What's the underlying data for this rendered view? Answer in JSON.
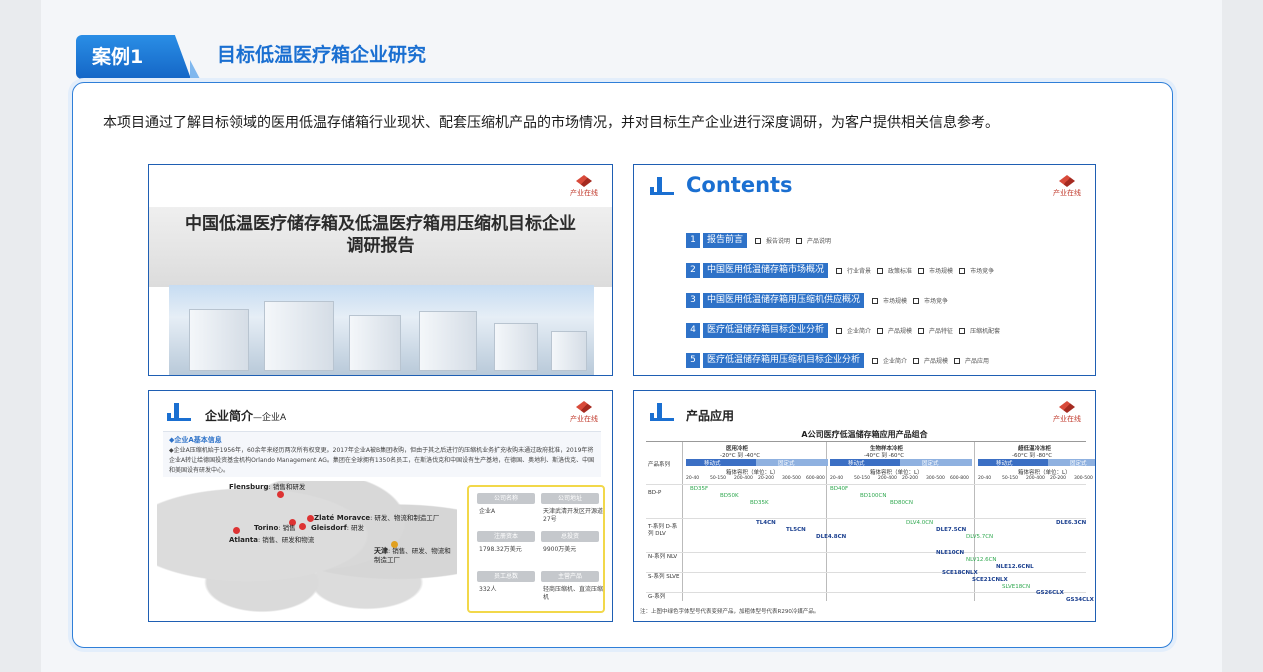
{
  "header": {
    "tag_label": "案例1",
    "title": "目标低温医疗箱企业研究"
  },
  "intro": "本项目通过了解目标领域的医用低温存储箱行业现状、配套压缩机产品的市场情况，并对目标生产企业进行深度调研，为客户提供相关信息参考。",
  "logo": {
    "text": "产业在线",
    "sub": "CHINAIOL.COM"
  },
  "cover": {
    "title_line1": "中国低温医疗储存箱及低温医疗箱用压缩机目标企业",
    "title_line2": "调研报告"
  },
  "contents": {
    "title": "Contents",
    "items": [
      {
        "num": "1",
        "label": "报告前言",
        "subs": [
          "报告说明",
          "产品说明"
        ]
      },
      {
        "num": "2",
        "label": "中国医用低温储存箱市场概况",
        "subs": [
          "行业背景",
          "政策标准",
          "市场规模",
          "市场竞争"
        ]
      },
      {
        "num": "3",
        "label": "中国医用低温储存箱用压缩机供应概况",
        "subs": [
          "市场规模",
          "市场竞争"
        ]
      },
      {
        "num": "4",
        "label": "医疗低温储存箱目标企业分析",
        "subs": [
          "企业简介",
          "产品规模",
          "产品特征",
          "压缩机配套"
        ]
      },
      {
        "num": "5",
        "label": "医疗低温储存箱用压缩机目标企业分析",
        "subs": [
          "企业简介",
          "产品规模",
          "产品应用"
        ]
      }
    ]
  },
  "company": {
    "heading": "企业简介",
    "heading_sub": "—企业A",
    "info_title": "◆企业A基本信息",
    "info_text": "◆企业A压缩机始于1956年，60余年来经历两次所有权变更。2017年企业A被B集团收购，但由于其之后进行的压缩机业务扩充收购未通过政府批准，2019年将企业A转让给德国投资基金机构Orlando Management AG。集团在全球拥有1350名员工，在斯洛伐克和中国设有生产基地，在德国、奥地利、斯洛伐克、中国和美国设有研发中心。",
    "cities": [
      {
        "name": "Flensburg",
        "desc": "销售和研发"
      },
      {
        "name": "Zlaté Moravce",
        "desc": "研发、物流和制造工厂"
      },
      {
        "name": "Torino",
        "desc": "销售"
      },
      {
        "name": "Gleisdorf",
        "desc": "研发"
      },
      {
        "name": "Atlanta",
        "desc": "销售、研发和物流"
      },
      {
        "name": "天津",
        "desc": "销售、研发、物流和制造工厂"
      }
    ],
    "facts": [
      {
        "label": "公司名称",
        "value": "企业A"
      },
      {
        "label": "公司地址",
        "value": "天津武清开发区开源道27号"
      },
      {
        "label": "注册资本",
        "value": "1798.32万美元"
      },
      {
        "label": "总投资",
        "value": "9900万美元"
      },
      {
        "label": "员工总数",
        "value": "332人"
      },
      {
        "label": "主营产品",
        "value": "轻商压缩机、直流压缩机"
      }
    ]
  },
  "application": {
    "heading": "产品应用",
    "table_title": "A公司医疗低温储存箱应用产品组合",
    "row_header": "产品系列",
    "groups": [
      {
        "name": "医用冷柜",
        "range": "-20°C 到 -40°C"
      },
      {
        "name": "生物样本冷柜",
        "range": "-40°C 到 -60°C"
      },
      {
        "name": "超低温冷冻柜",
        "range": "-60°C 到 -80°C"
      }
    ],
    "sub_labels": [
      "移动式",
      "固定式"
    ],
    "volume_label": "箱体容积（单位：L）",
    "volume_ticks": [
      "20-40",
      "50-150",
      "200-400",
      "20-200",
      "300-500",
      "600-800"
    ],
    "series": [
      {
        "name": "BD-P",
        "models": [
          "BD35F",
          "BD50K",
          "BD35K",
          "BD40F",
          "BD100CN",
          "BD80CN"
        ]
      },
      {
        "name": "T-系列 D-系列 DLV",
        "models": [
          "TL4CN",
          "TL5CN",
          "DLE4.8CN",
          "DLV4.0CN",
          "DLE7.5CN",
          "DLV5.7CN",
          "DLE6.3CN"
        ]
      },
      {
        "name": "N-系列 NLV",
        "models": [
          "NLE10CN",
          "NLV12.6CN",
          "NLE12.6CNL"
        ]
      },
      {
        "name": "S-系列 SLVE",
        "models": [
          "SCE18CNLX",
          "SCE21CNLX",
          "SLVE18CN"
        ]
      },
      {
        "name": "G-系列",
        "models": [
          "GS26CLX",
          "GS34CLX"
        ]
      }
    ],
    "note": "注：上图中绿色字体型号代表变频产品，加粗体型号代表R290冷媒产品。"
  },
  "colors": {
    "accent": "#1a6fd1",
    "border": "#1f5fb3",
    "highlight": "#f2d84a"
  }
}
